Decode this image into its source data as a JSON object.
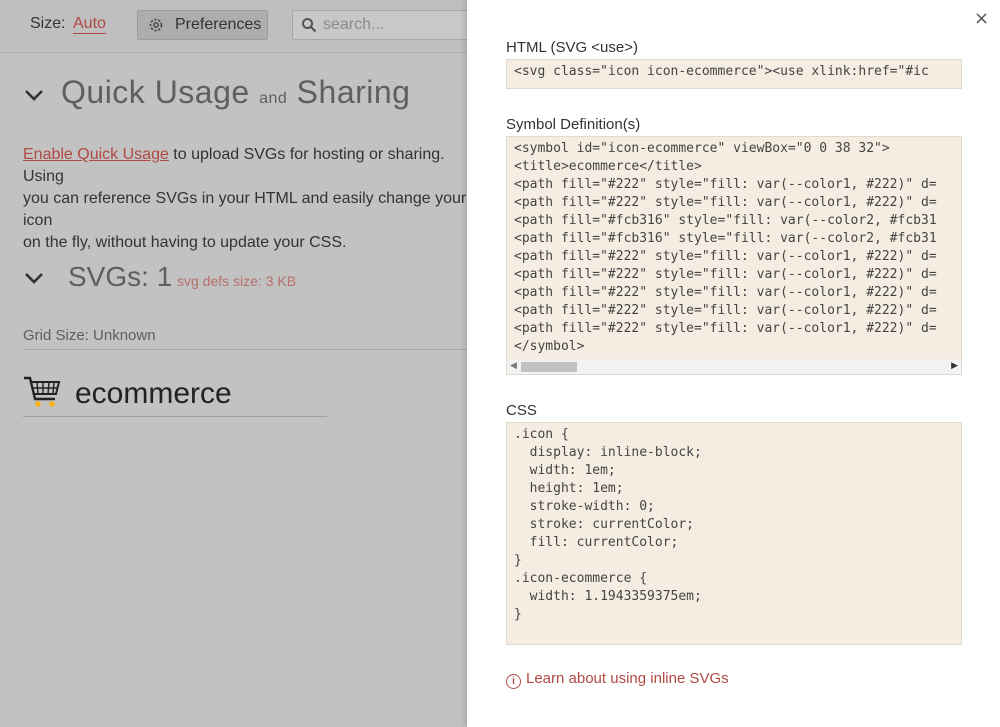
{
  "toolbar": {
    "size_label": "Size:",
    "size_value": "Auto",
    "preferences_label": "Preferences",
    "search_placeholder": "search..."
  },
  "quick_usage": {
    "title_part1": "Quick Usage",
    "title_and": "and",
    "title_part2": "Sharing",
    "enable_link": "Enable Quick Usage",
    "enable_text_line1": " to upload SVGs for hosting or sharing. Using",
    "enable_text_line2": "you can reference SVGs in your HTML and easily change your icon",
    "enable_text_line3": "on the fly, without having to update your CSS."
  },
  "svgs": {
    "title": "SVGs: 1",
    "defs_size": "svg defs size: 3 KB",
    "grid_size": "Grid Size: Unknown",
    "icon_name": "ecommerce"
  },
  "panel": {
    "close_glyph": "×",
    "html_label": "HTML (SVG <use>)",
    "html_code": "<svg class=\"icon icon-ecommerce\"><use xlink:href=\"#ic",
    "symbol_label": "Symbol Definition(s)",
    "symbol_lines": [
      "<symbol id=\"icon-ecommerce\" viewBox=\"0 0 38 32\">",
      "<title>ecommerce</title>",
      "<path fill=\"#222\" style=\"fill: var(--color1, #222)\" d=",
      "<path fill=\"#222\" style=\"fill: var(--color1, #222)\" d=",
      "<path fill=\"#fcb316\" style=\"fill: var(--color2, #fcb31",
      "<path fill=\"#fcb316\" style=\"fill: var(--color2, #fcb31",
      "<path fill=\"#222\" style=\"fill: var(--color1, #222)\" d=",
      "<path fill=\"#222\" style=\"fill: var(--color1, #222)\" d=",
      "<path fill=\"#222\" style=\"fill: var(--color1, #222)\" d=",
      "<path fill=\"#222\" style=\"fill: var(--color1, #222)\" d=",
      "<path fill=\"#222\" style=\"fill: var(--color1, #222)\" d=",
      "</symbol>"
    ],
    "css_label": "CSS",
    "css_lines": [
      ".icon {",
      "  display: inline-block;",
      "  width: 1em;",
      "  height: 1em;",
      "  stroke-width: 0;",
      "  stroke: currentColor;",
      "  fill: currentColor;",
      "}",
      ".icon-ecommerce {",
      "  width: 1.1943359375em;",
      "}"
    ],
    "learn_link": "Learn about using inline SVGs"
  },
  "colors": {
    "accent": "#b04a43",
    "code_bg": "#f5ede1",
    "overlay_bg": "#c2c2c2",
    "cart_orange": "#fcb316"
  },
  "icons": [
    "gear-icon",
    "search-icon",
    "chevron-down-icon",
    "cart-icon",
    "close-icon",
    "info-icon"
  ]
}
